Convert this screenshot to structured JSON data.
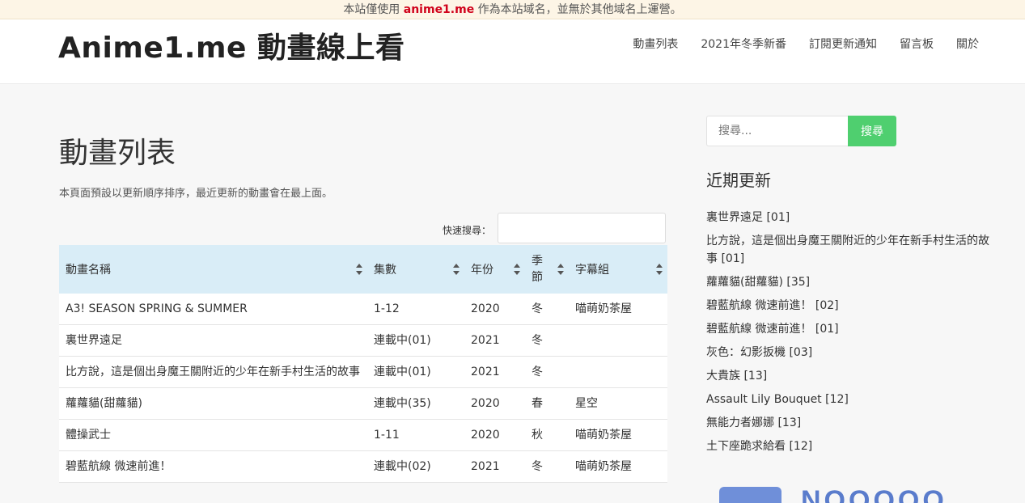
{
  "notice": {
    "before": "本站僅使用 ",
    "domain": "anime1.me",
    "after": " 作為本站域名，並無於其他域名上運營。"
  },
  "header": {
    "site_title": "Anime1.me 動畫線上看",
    "nav": [
      "動畫列表",
      "2021年冬季新番",
      "訂閱更新通知",
      "留言板",
      "關於"
    ]
  },
  "main": {
    "page_title": "動畫列表",
    "intro": "本頁面預設以更新順序排序，最近更新的動畫會在最上面。",
    "quick_search_label": "快速搜尋：",
    "table": {
      "headers": [
        "動畫名稱",
        "集數",
        "年份",
        "季節",
        "字幕組"
      ],
      "rows": [
        [
          "A3! SEASON SPRING & SUMMER",
          "1-12",
          "2020",
          "冬",
          "喵萌奶茶屋"
        ],
        [
          "裏世界遠足",
          "連載中(01)",
          "2021",
          "冬",
          ""
        ],
        [
          "比方說，這是個出身魔王關附近的少年在新手村生活的故事",
          "連載中(01)",
          "2021",
          "冬",
          ""
        ],
        [
          "蘿蘿貓(甜蘿貓)",
          "連載中(35)",
          "2020",
          "春",
          "星空"
        ],
        [
          "體操武士",
          "1-11",
          "2020",
          "秋",
          "喵萌奶茶屋"
        ],
        [
          "碧藍航線 微速前進！",
          "連載中(02)",
          "2021",
          "冬",
          "喵萌奶茶屋"
        ]
      ]
    }
  },
  "sidebar": {
    "search_placeholder": "搜尋...",
    "search_button": "搜尋",
    "recent_title": "近期更新",
    "recent": [
      "裏世界遠足 [01]",
      "比方說，這是個出身魔王關附近的少年在新手村生活的故事 [01]",
      "蘿蘿貓(甜蘿貓) [35]",
      "碧藍航線 微速前進！ [02]",
      "碧藍航線 微速前進！ [01]",
      "灰色：幻影扳機 [03]",
      "大貴族 [13]",
      "Assault Lily Bouquet [12]",
      "無能力者娜娜 [13]",
      "土下座跪求給看 [12]"
    ],
    "ad_text": "NOOOOO"
  }
}
